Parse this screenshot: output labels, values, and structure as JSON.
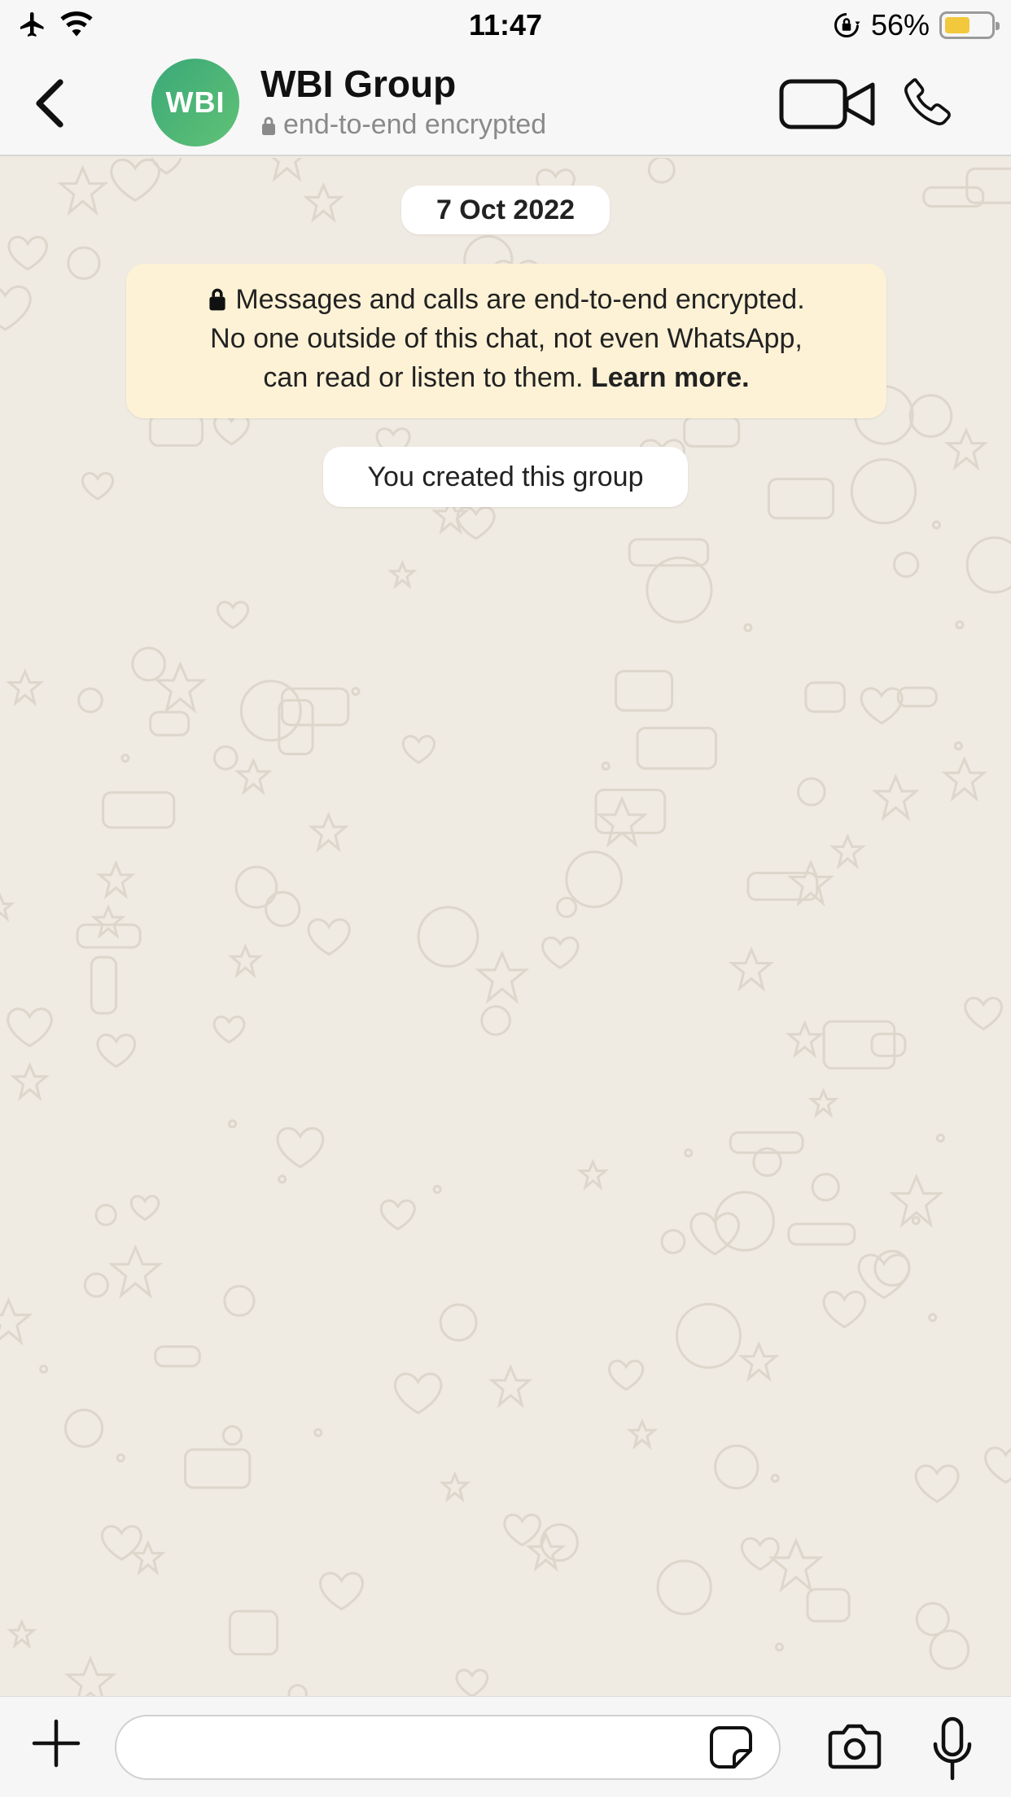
{
  "status_bar": {
    "time": "11:47",
    "battery_percent": "56%",
    "battery_level": 0.56,
    "icons": [
      "airplane-icon",
      "wifi-icon",
      "rotation-lock-icon",
      "battery-icon"
    ]
  },
  "header": {
    "avatar_initials": "WBI",
    "group_name": "WBI Group",
    "subtitle": "end-to-end encrypted",
    "icons": [
      "back-chevron-icon",
      "lock-icon",
      "video-camera-icon",
      "phone-icon"
    ]
  },
  "chat": {
    "date_label": "7 Oct 2022",
    "encryption_notice": {
      "line1": "Messages and calls are end-to-end encrypted.",
      "line2": "No one outside of this chat, not even WhatsApp,",
      "line3_prefix": "can read or listen to them. ",
      "learn_more": "Learn more."
    },
    "system_message": "You created this group"
  },
  "input_bar": {
    "placeholder": "",
    "icons": [
      "plus-icon",
      "sticker-icon",
      "camera-icon",
      "microphone-icon"
    ]
  },
  "colors": {
    "chat_background": "#efeae2",
    "notice_background": "#fdf2d6",
    "avatar_green": "#4cb577",
    "battery_yellow": "#f2c83c"
  }
}
